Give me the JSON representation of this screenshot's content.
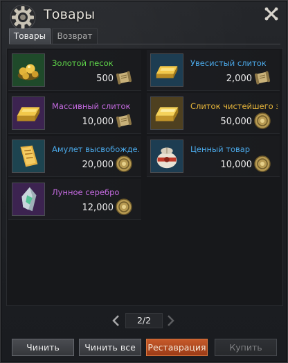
{
  "window": {
    "title": "Товары"
  },
  "tabs": [
    {
      "label": "Товары",
      "active": true
    },
    {
      "label": "Возврат",
      "active": false
    }
  ],
  "items": [
    {
      "name": "Золотой песок",
      "price": "500",
      "name_color": "#5fd64a",
      "currency": "scroll-icon",
      "icon": "gold-sand-icon"
    },
    {
      "name": "Увесистый слиток",
      "price": "2,000",
      "name_color": "#4aa8e8",
      "currency": "scroll-icon",
      "icon": "heavy-ingot-icon"
    },
    {
      "name": "Массивный слиток",
      "price": "10,000",
      "name_color": "#c46ae0",
      "currency": "scroll-icon",
      "icon": "massive-ingot-icon"
    },
    {
      "name": "Слиток чистейшего з...",
      "price": "50,000",
      "name_color": "#e8b63a",
      "currency": "coin-icon",
      "icon": "pure-gold-ingot-icon"
    },
    {
      "name": "Амулет высвобожде...",
      "price": "20,000",
      "name_color": "#4aa8e8",
      "currency": "coin-icon",
      "icon": "amulet-icon"
    },
    {
      "name": "Ценный товар",
      "price": "10,000",
      "name_color": "#4aa8e8",
      "currency": "coin-icon",
      "icon": "valuable-goods-icon"
    },
    {
      "name": "Лунное серебро",
      "price": "12,000",
      "name_color": "#c46ae0",
      "currency": "coin-icon",
      "icon": "moon-silver-icon"
    }
  ],
  "pagination": {
    "text": "2/2"
  },
  "buttons": {
    "repair": "Чинить",
    "repair_all": "Чинить все",
    "restore": "Реставрация",
    "buy": "Купить"
  }
}
